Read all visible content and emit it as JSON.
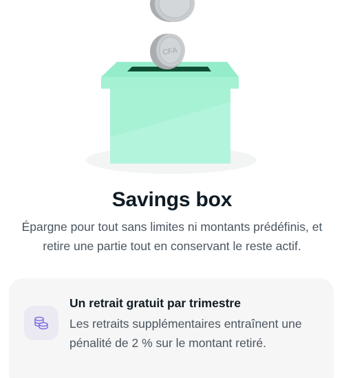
{
  "savings": {
    "title": "Savings box",
    "description": "Épargne pour tout sans limites ni montants prédéfinis, et retire une partie tout en conservant le reste actif.",
    "coin_label": "CFA"
  },
  "info_card": {
    "title": "Un retrait gratuit par trimestre",
    "text": "Les retraits supplémentaires entraînent une pénalité de 2 % sur le montant retiré.",
    "icon": "coins-stack-icon"
  },
  "colors": {
    "box_front": "#a7f2d5",
    "box_lid": "#95eccb",
    "slot": "#0f4d32",
    "coin": "#c9cccf",
    "icon_tile": "#ebeaf3",
    "icon_stroke": "#7d6fe3",
    "card_bg": "#f6f6f6",
    "title_text": "#0f1b24",
    "body_text": "#4a5560"
  }
}
